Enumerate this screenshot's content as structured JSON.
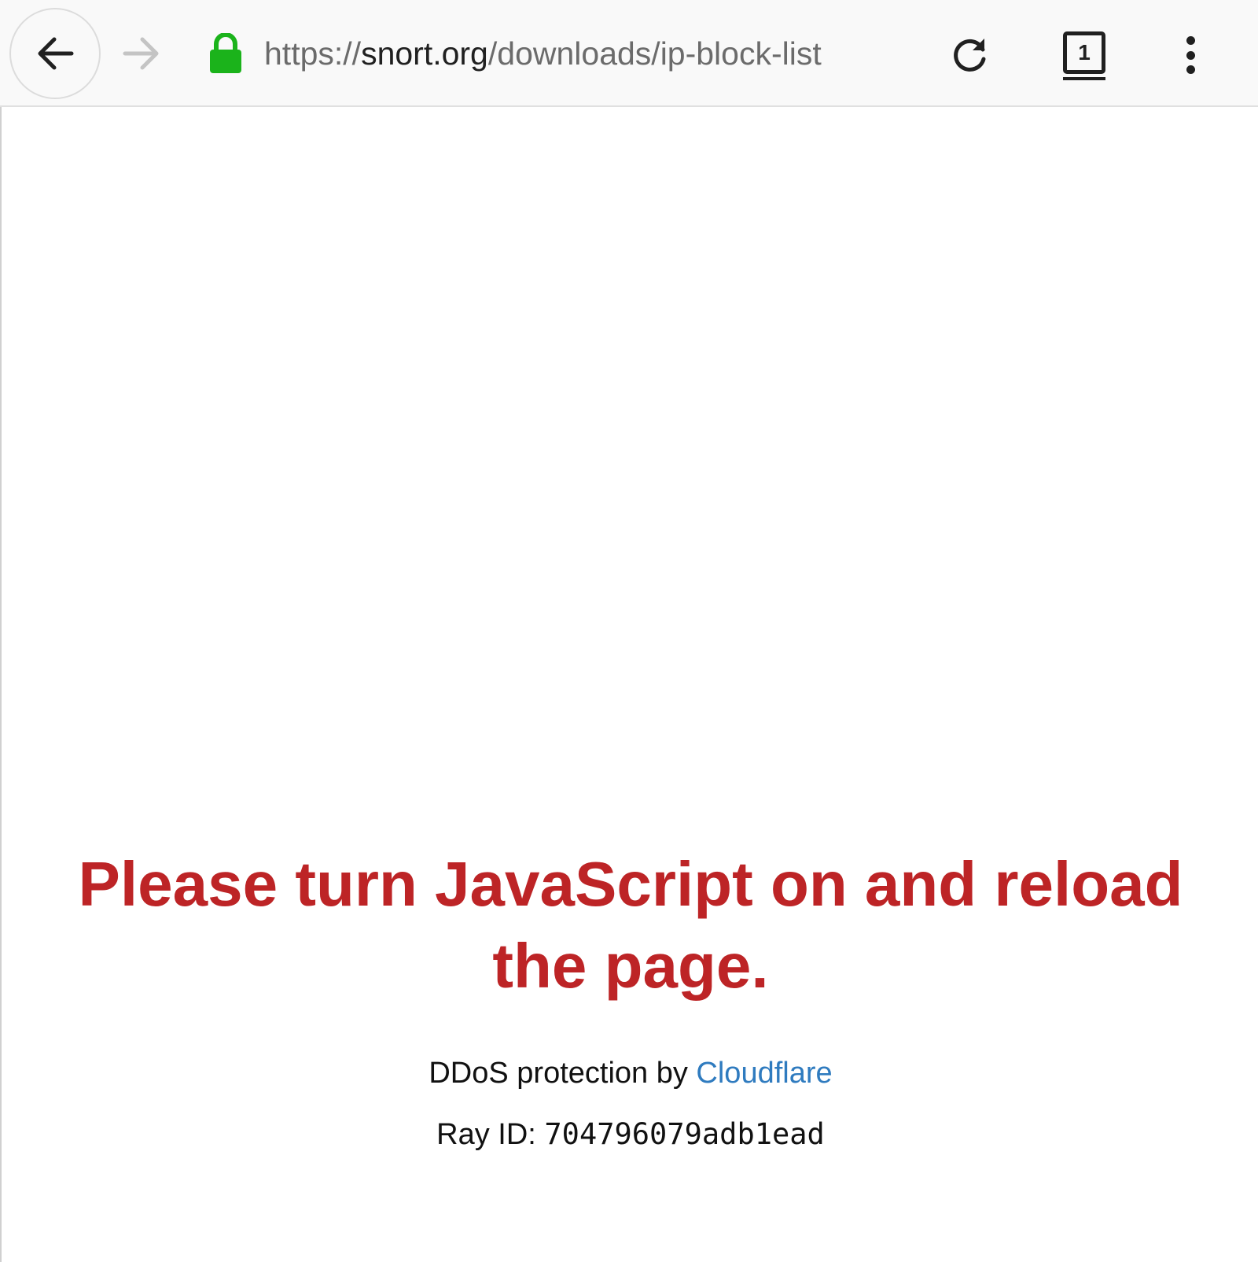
{
  "browser": {
    "url_scheme": "https://",
    "url_domain": "snort.org",
    "url_path": "/downloads/ip-block-list",
    "tab_count": "1",
    "icons": {
      "back": "arrow-left-icon",
      "forward": "arrow-right-icon",
      "secure": "lock-icon",
      "reload": "reload-icon",
      "tabs": "tabs-icon",
      "menu": "more-vertical-icon"
    },
    "colors": {
      "lock": "#1bb31b",
      "forward_disabled": "#c4c4c4"
    }
  },
  "page": {
    "message": "Please turn JavaScript on and reload the page.",
    "ddos_prefix": "DDoS protection by ",
    "ddos_link": "Cloudflare",
    "ray_label": "Ray ID: ",
    "ray_id": "704796079adb1ead",
    "colors": {
      "message": "#bd2426",
      "link": "#2f7bbf"
    }
  }
}
